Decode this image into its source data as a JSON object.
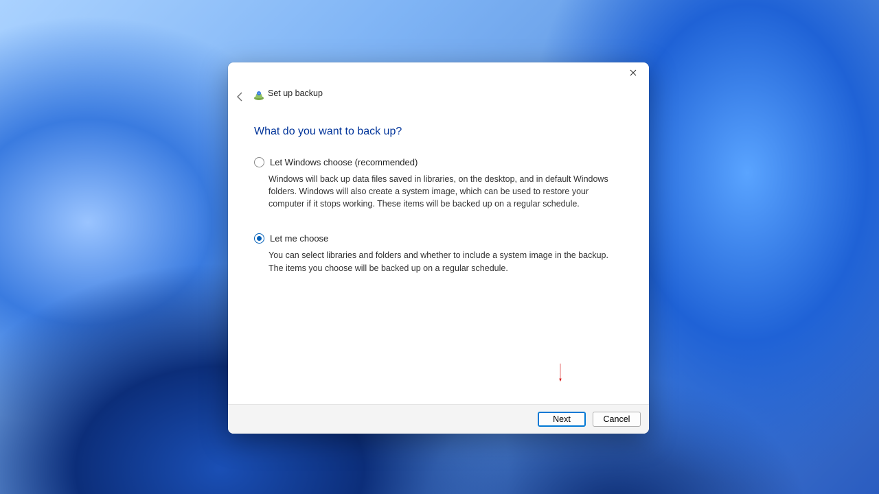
{
  "window": {
    "title": "Set up backup"
  },
  "heading": "What do you want to back up?",
  "options": [
    {
      "label": "Let Windows choose (recommended)",
      "description": "Windows will back up data files saved in libraries, on the desktop, and in default Windows folders. Windows will also create a system image, which can be used to restore your computer if it stops working. These items will be backed up on a regular schedule.",
      "selected": false
    },
    {
      "label": "Let me choose",
      "description": "You can select libraries and folders and whether to include a system image in the backup. The items you choose will be backed up on a regular schedule.",
      "selected": true
    }
  ],
  "buttons": {
    "next": "Next",
    "cancel": "Cancel"
  },
  "annotation": {
    "arrow_color": "#d40000"
  }
}
